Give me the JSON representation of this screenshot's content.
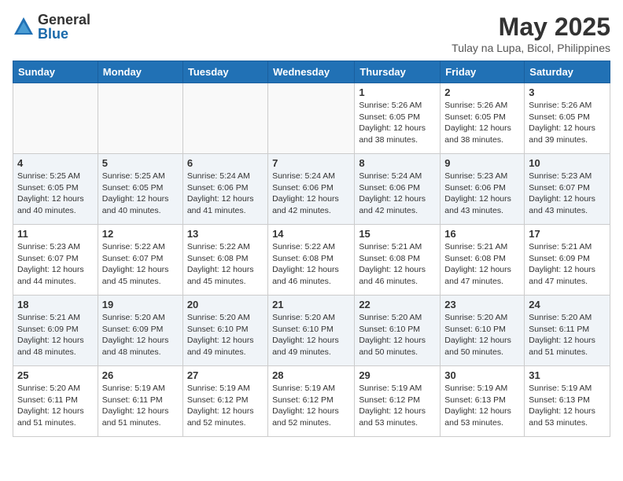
{
  "logo": {
    "general": "General",
    "blue": "Blue"
  },
  "title": {
    "month_year": "May 2025",
    "location": "Tulay na Lupa, Bicol, Philippines"
  },
  "days_of_week": [
    "Sunday",
    "Monday",
    "Tuesday",
    "Wednesday",
    "Thursday",
    "Friday",
    "Saturday"
  ],
  "weeks": [
    [
      {
        "day": "",
        "info": ""
      },
      {
        "day": "",
        "info": ""
      },
      {
        "day": "",
        "info": ""
      },
      {
        "day": "",
        "info": ""
      },
      {
        "day": "1",
        "info": "Sunrise: 5:26 AM\nSunset: 6:05 PM\nDaylight: 12 hours\nand 38 minutes."
      },
      {
        "day": "2",
        "info": "Sunrise: 5:26 AM\nSunset: 6:05 PM\nDaylight: 12 hours\nand 38 minutes."
      },
      {
        "day": "3",
        "info": "Sunrise: 5:26 AM\nSunset: 6:05 PM\nDaylight: 12 hours\nand 39 minutes."
      }
    ],
    [
      {
        "day": "4",
        "info": "Sunrise: 5:25 AM\nSunset: 6:05 PM\nDaylight: 12 hours\nand 40 minutes."
      },
      {
        "day": "5",
        "info": "Sunrise: 5:25 AM\nSunset: 6:05 PM\nDaylight: 12 hours\nand 40 minutes."
      },
      {
        "day": "6",
        "info": "Sunrise: 5:24 AM\nSunset: 6:06 PM\nDaylight: 12 hours\nand 41 minutes."
      },
      {
        "day": "7",
        "info": "Sunrise: 5:24 AM\nSunset: 6:06 PM\nDaylight: 12 hours\nand 42 minutes."
      },
      {
        "day": "8",
        "info": "Sunrise: 5:24 AM\nSunset: 6:06 PM\nDaylight: 12 hours\nand 42 minutes."
      },
      {
        "day": "9",
        "info": "Sunrise: 5:23 AM\nSunset: 6:06 PM\nDaylight: 12 hours\nand 43 minutes."
      },
      {
        "day": "10",
        "info": "Sunrise: 5:23 AM\nSunset: 6:07 PM\nDaylight: 12 hours\nand 43 minutes."
      }
    ],
    [
      {
        "day": "11",
        "info": "Sunrise: 5:23 AM\nSunset: 6:07 PM\nDaylight: 12 hours\nand 44 minutes."
      },
      {
        "day": "12",
        "info": "Sunrise: 5:22 AM\nSunset: 6:07 PM\nDaylight: 12 hours\nand 45 minutes."
      },
      {
        "day": "13",
        "info": "Sunrise: 5:22 AM\nSunset: 6:08 PM\nDaylight: 12 hours\nand 45 minutes."
      },
      {
        "day": "14",
        "info": "Sunrise: 5:22 AM\nSunset: 6:08 PM\nDaylight: 12 hours\nand 46 minutes."
      },
      {
        "day": "15",
        "info": "Sunrise: 5:21 AM\nSunset: 6:08 PM\nDaylight: 12 hours\nand 46 minutes."
      },
      {
        "day": "16",
        "info": "Sunrise: 5:21 AM\nSunset: 6:08 PM\nDaylight: 12 hours\nand 47 minutes."
      },
      {
        "day": "17",
        "info": "Sunrise: 5:21 AM\nSunset: 6:09 PM\nDaylight: 12 hours\nand 47 minutes."
      }
    ],
    [
      {
        "day": "18",
        "info": "Sunrise: 5:21 AM\nSunset: 6:09 PM\nDaylight: 12 hours\nand 48 minutes."
      },
      {
        "day": "19",
        "info": "Sunrise: 5:20 AM\nSunset: 6:09 PM\nDaylight: 12 hours\nand 48 minutes."
      },
      {
        "day": "20",
        "info": "Sunrise: 5:20 AM\nSunset: 6:10 PM\nDaylight: 12 hours\nand 49 minutes."
      },
      {
        "day": "21",
        "info": "Sunrise: 5:20 AM\nSunset: 6:10 PM\nDaylight: 12 hours\nand 49 minutes."
      },
      {
        "day": "22",
        "info": "Sunrise: 5:20 AM\nSunset: 6:10 PM\nDaylight: 12 hours\nand 50 minutes."
      },
      {
        "day": "23",
        "info": "Sunrise: 5:20 AM\nSunset: 6:10 PM\nDaylight: 12 hours\nand 50 minutes."
      },
      {
        "day": "24",
        "info": "Sunrise: 5:20 AM\nSunset: 6:11 PM\nDaylight: 12 hours\nand 51 minutes."
      }
    ],
    [
      {
        "day": "25",
        "info": "Sunrise: 5:20 AM\nSunset: 6:11 PM\nDaylight: 12 hours\nand 51 minutes."
      },
      {
        "day": "26",
        "info": "Sunrise: 5:19 AM\nSunset: 6:11 PM\nDaylight: 12 hours\nand 51 minutes."
      },
      {
        "day": "27",
        "info": "Sunrise: 5:19 AM\nSunset: 6:12 PM\nDaylight: 12 hours\nand 52 minutes."
      },
      {
        "day": "28",
        "info": "Sunrise: 5:19 AM\nSunset: 6:12 PM\nDaylight: 12 hours\nand 52 minutes."
      },
      {
        "day": "29",
        "info": "Sunrise: 5:19 AM\nSunset: 6:12 PM\nDaylight: 12 hours\nand 53 minutes."
      },
      {
        "day": "30",
        "info": "Sunrise: 5:19 AM\nSunset: 6:13 PM\nDaylight: 12 hours\nand 53 minutes."
      },
      {
        "day": "31",
        "info": "Sunrise: 5:19 AM\nSunset: 6:13 PM\nDaylight: 12 hours\nand 53 minutes."
      }
    ]
  ]
}
